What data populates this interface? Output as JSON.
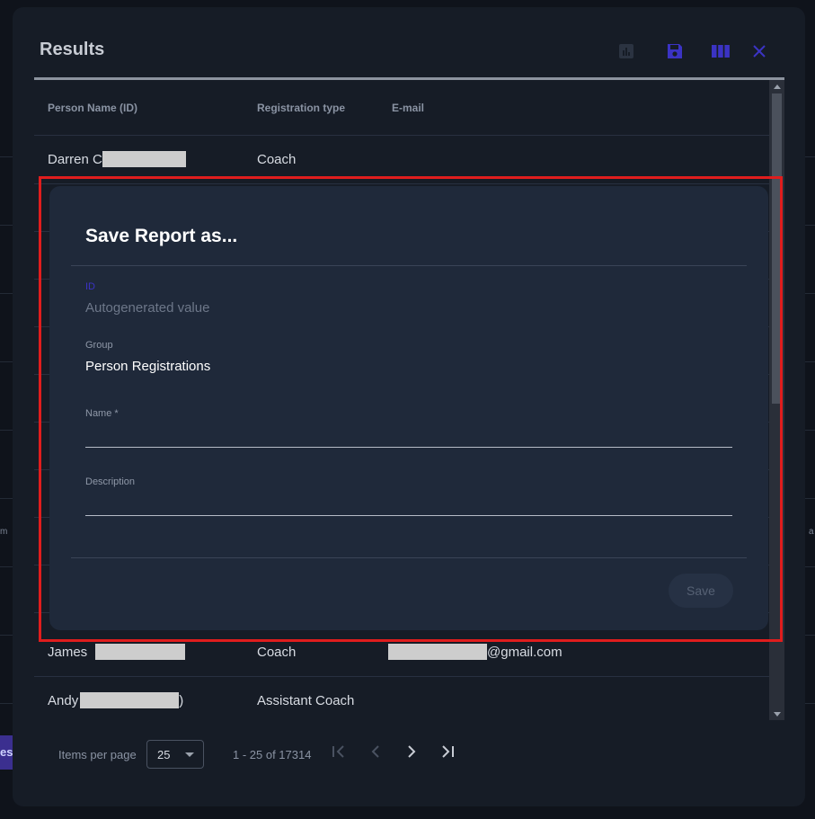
{
  "results": {
    "title": "Results",
    "toolbar": {
      "chart_icon": "chart-icon",
      "save_icon": "save-icon",
      "columns_icon": "columns-icon",
      "close_icon": "close-icon"
    },
    "columns": [
      "Person Name (ID)",
      "Registration type",
      "E-mail"
    ],
    "rows": [
      {
        "name": "Darren C",
        "type": "Coach",
        "email": ""
      },
      {
        "name": "James",
        "type": "Coach",
        "email": "@gmail.com"
      },
      {
        "name": "Andy",
        "type": "Assistant Coach",
        "email": ""
      }
    ],
    "andy_suffix": ")",
    "pagination": {
      "items_per_page_label": "Items per page",
      "items_per_page": "25",
      "range": "1 - 25 of 17314"
    }
  },
  "background": {
    "tab_label": "ese",
    "left_fragment": "m",
    "right_fragment": "a"
  },
  "dialog": {
    "title": "Save Report as...",
    "id_label": "ID",
    "id_value": "Autogenerated value",
    "group_label": "Group",
    "group_value": "Person Registrations",
    "name_label": "Name *",
    "name_value": "",
    "description_label": "Description",
    "description_value": "",
    "save_label": "Save"
  },
  "colors": {
    "accent": "#3b33c4",
    "highlight": "#e01d1d",
    "dialog_bg": "#1f293a",
    "panel_bg": "#161c26"
  }
}
